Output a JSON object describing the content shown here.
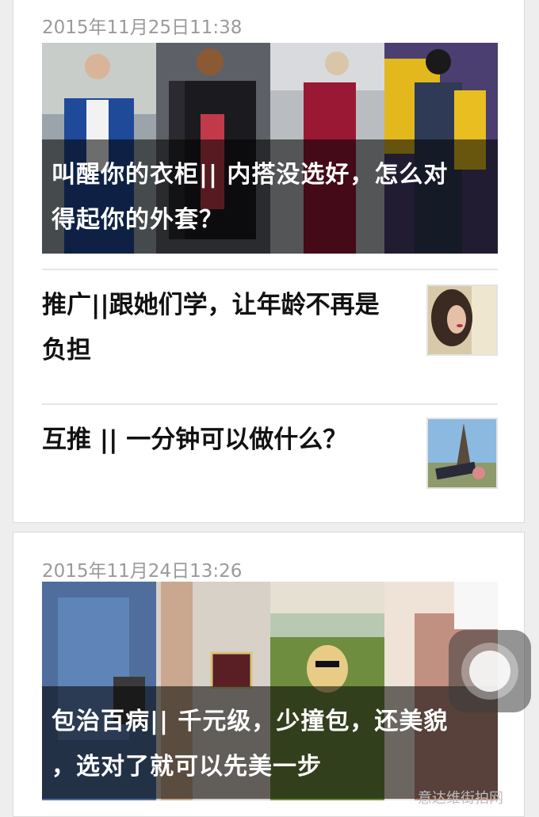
{
  "feed": {
    "groups": [
      {
        "date": "2015年11月25日11:38",
        "cover_title_line1": "叫醒你的衣柜|| 内搭没选好，怎么对",
        "cover_title_line2": "得起你的外套？",
        "items": [
          {
            "title_line1": "推广||跟她们学，让年龄不再是",
            "title_line2": "负担"
          },
          {
            "title_line1": "互推 || 一分钟可以做什么？",
            "title_line2": ""
          }
        ]
      },
      {
        "date": "2015年11月24日13:26",
        "cover_title_line1": "包治百病|| 千元级，少撞包，还美貌",
        "cover_title_line2": "，选对了就可以先美一步"
      }
    ]
  },
  "watermark": "意达维街拍网",
  "floating_button_icon": "assistive-touch-icon"
}
